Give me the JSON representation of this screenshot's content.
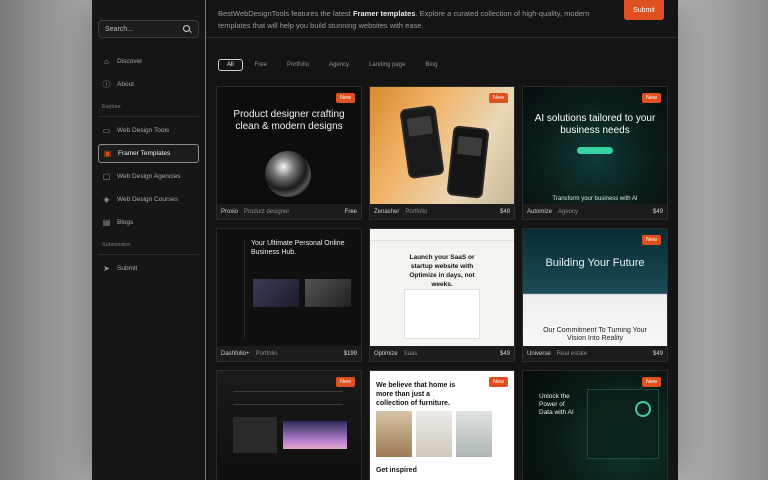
{
  "sidebar": {
    "search_placeholder": "Search...",
    "nav_primary": [
      {
        "label": "Discover",
        "icon": "home-icon"
      },
      {
        "label": "About",
        "icon": "info-icon"
      }
    ],
    "section_explore": "Explore",
    "nav_explore": [
      {
        "label": "Web Design Tools",
        "icon": "tools-icon"
      },
      {
        "label": "Framer Templates",
        "icon": "template-icon",
        "active": true
      },
      {
        "label": "Web Design Agencies",
        "icon": "monitor-icon"
      },
      {
        "label": "Web Design Courses",
        "icon": "graduation-cap-icon"
      },
      {
        "label": "Blogs",
        "icon": "document-icon"
      }
    ],
    "section_submission": "Submission",
    "nav_submission": [
      {
        "label": "Submit",
        "icon": "send-icon"
      }
    ]
  },
  "header": {
    "intro_prefix": "BestWebDesignTools features the latest ",
    "intro_bold": "Framer templates",
    "intro_suffix": ". Explore a curated collection of high-quality, modern templates that will help you build stunning websites with ease.",
    "submit_label": "Submit"
  },
  "filters": [
    "All",
    "Free",
    "Portfolio",
    "Agency",
    "Landing page",
    "Blog"
  ],
  "cards": [
    {
      "name": "Proxio",
      "category": "Product designer",
      "price": "Free",
      "badge": "New",
      "thumb_title": "Product designer crafting clean & modern designs"
    },
    {
      "name": "Zenasher",
      "category": "Portfolio",
      "price": "$49",
      "badge": "New"
    },
    {
      "name": "Automize",
      "category": "Agency",
      "price": "$49",
      "badge": "New",
      "thumb_title": "AI solutions tailored to your business needs",
      "thumb_sub": "Transform your business with AI"
    },
    {
      "name": "Dashfolio+",
      "category": "Portfolio",
      "price": "$199",
      "thumb_title": "Your Ultimate Personal Online Business Hub."
    },
    {
      "name": "Optimize",
      "category": "Saas",
      "price": "$49",
      "thumb_title": "Launch your SaaS or startup website with Optimize in days, not weeks."
    },
    {
      "name": "Universe",
      "category": "Real estate",
      "price": "$49",
      "badge": "New",
      "thumb_title": "Building Your Future",
      "thumb_sub": "Our Commitment To Turning Your Vision Into Reality"
    },
    {
      "name": "",
      "category": "",
      "price": "",
      "badge": "New"
    },
    {
      "name": "",
      "category": "",
      "price": "",
      "badge": "New",
      "thumb_title": "We believe that home is more than just a collection of furniture.",
      "thumb_sub": "Get inspired"
    },
    {
      "name": "",
      "category": "",
      "price": "",
      "badge": "New",
      "thumb_title": "Unlock the Power of Data with AI"
    }
  ],
  "colors": {
    "accent": "#e0501f",
    "app_bg": "#141414"
  }
}
